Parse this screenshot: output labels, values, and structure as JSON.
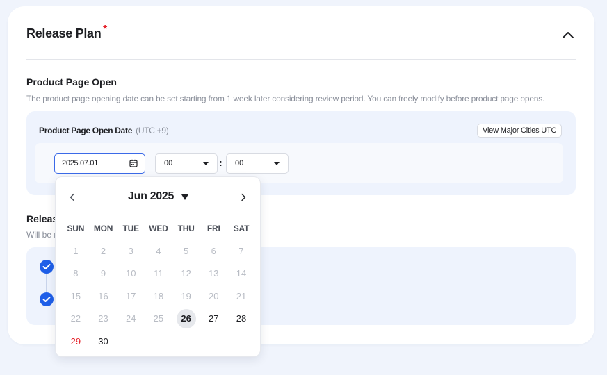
{
  "release_plan": {
    "title": "Release Plan",
    "required_mark": "*"
  },
  "product_page": {
    "title": "Product Page Open",
    "description": "The product page opening date can be set starting from 1 week later considering review period. You can freely modify before product page opens.",
    "field_label": "Product Page Open Date",
    "timezone": "(UTC +9)",
    "cities_button": "View Major Cities UTC",
    "date_value": "2025.07.01",
    "hour_value": "00",
    "minute_value": "00",
    "separator": ":"
  },
  "release": {
    "title_partial": "Releas",
    "desc_partial": "Will be r"
  },
  "calendar": {
    "month_label": "Jun 2025",
    "weekdays": [
      "SUN",
      "MON",
      "TUE",
      "WED",
      "THU",
      "FRI",
      "SAT"
    ],
    "days": [
      {
        "d": "1",
        "enabled": false
      },
      {
        "d": "2",
        "enabled": false
      },
      {
        "d": "3",
        "enabled": false
      },
      {
        "d": "4",
        "enabled": false
      },
      {
        "d": "5",
        "enabled": false
      },
      {
        "d": "6",
        "enabled": false
      },
      {
        "d": "7",
        "enabled": false
      },
      {
        "d": "8",
        "enabled": false
      },
      {
        "d": "9",
        "enabled": false
      },
      {
        "d": "10",
        "enabled": false
      },
      {
        "d": "11",
        "enabled": false
      },
      {
        "d": "12",
        "enabled": false
      },
      {
        "d": "13",
        "enabled": false
      },
      {
        "d": "14",
        "enabled": false
      },
      {
        "d": "15",
        "enabled": false
      },
      {
        "d": "16",
        "enabled": false
      },
      {
        "d": "17",
        "enabled": false
      },
      {
        "d": "18",
        "enabled": false
      },
      {
        "d": "19",
        "enabled": false
      },
      {
        "d": "20",
        "enabled": false
      },
      {
        "d": "21",
        "enabled": false
      },
      {
        "d": "22",
        "enabled": false
      },
      {
        "d": "23",
        "enabled": false
      },
      {
        "d": "24",
        "enabled": false
      },
      {
        "d": "25",
        "enabled": false
      },
      {
        "d": "26",
        "enabled": true,
        "selected": true
      },
      {
        "d": "27",
        "enabled": true
      },
      {
        "d": "28",
        "enabled": true
      },
      {
        "d": "29",
        "enabled": true,
        "sunday": true
      },
      {
        "d": "30",
        "enabled": true
      }
    ]
  },
  "colors": {
    "accent": "#1f5fe8",
    "required": "#e5232b",
    "panel_bg": "#eef3fd"
  },
  "icons": [
    "chevron-up-icon",
    "calendar-icon",
    "chevron-left-icon",
    "chevron-right-icon",
    "check-icon"
  ]
}
